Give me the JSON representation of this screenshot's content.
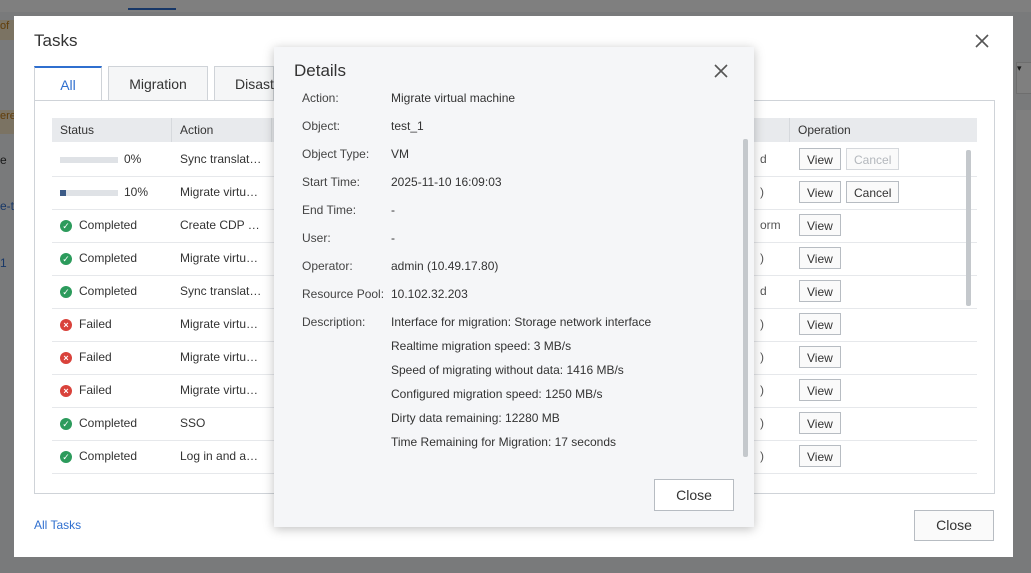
{
  "background": {
    "left_fragments": [
      "of",
      "ere",
      "e",
      "e-t",
      "1"
    ],
    "right_fragment": "▾"
  },
  "tasks_dialog": {
    "title": "Tasks",
    "tabs": [
      {
        "label": "All",
        "active": true
      },
      {
        "label": "Migration",
        "active": false
      },
      {
        "label": "Disast",
        "active": false
      }
    ],
    "table": {
      "headers": [
        "Status",
        "Action",
        "",
        "Operation"
      ],
      "rows": [
        {
          "status_type": "progress",
          "status": "0%",
          "progress": 0,
          "action": "Sync translat…",
          "tail": "d",
          "view": "View",
          "cancel": "Cancel",
          "cancel_enabled": false
        },
        {
          "status_type": "progress",
          "status": "10%",
          "progress": 10,
          "action": "Migrate virtu…",
          "tail": ")",
          "view": "View",
          "cancel": "Cancel",
          "cancel_enabled": true
        },
        {
          "status_type": "completed",
          "status": "Completed",
          "action": "Create CDP …",
          "tail": "orm",
          "view": "View"
        },
        {
          "status_type": "completed",
          "status": "Completed",
          "action": "Migrate virtu…",
          "tail": ")",
          "view": "View"
        },
        {
          "status_type": "completed",
          "status": "Completed",
          "action": "Sync translat…",
          "tail": "d",
          "view": "View"
        },
        {
          "status_type": "failed",
          "status": "Failed",
          "action": "Migrate virtu…",
          "tail": ")",
          "view": "View"
        },
        {
          "status_type": "failed",
          "status": "Failed",
          "action": "Migrate virtu…",
          "tail": ")",
          "view": "View"
        },
        {
          "status_type": "failed",
          "status": "Failed",
          "action": "Migrate virtu…",
          "tail": ")",
          "view": "View"
        },
        {
          "status_type": "completed",
          "status": "Completed",
          "action": "SSO",
          "tail": ")",
          "view": "View"
        },
        {
          "status_type": "completed",
          "status": "Completed",
          "action": "Log in and a…",
          "tail": ")",
          "view": "View"
        }
      ]
    },
    "all_tasks_link": "All Tasks",
    "close_label": "Close"
  },
  "details_dialog": {
    "title": "Details",
    "fields": [
      {
        "label": "Action:",
        "value": "Migrate virtual machine"
      },
      {
        "label": "Object:",
        "value": "test_1"
      },
      {
        "label": "Object Type:",
        "value": "VM"
      },
      {
        "label": "Start Time:",
        "value": "2025-11-10 16:09:03"
      },
      {
        "label": "End Time:",
        "value": "-"
      },
      {
        "label": "User:",
        "value": "-"
      },
      {
        "label": "Operator:",
        "value": "admin (10.49.17.80)"
      },
      {
        "label": "Resource Pool:",
        "value": "10.102.32.203"
      },
      {
        "label": "Description:",
        "value": "Interface for migration: Storage network interface"
      }
    ],
    "description_extra": [
      "Realtime migration speed: 3 MB/s",
      "Speed of migrating without data: 1416 MB/s",
      "Configured migration speed: 1250 MB/s",
      "Dirty data remaining: 12280 MB",
      "Time Remaining for Migration: 17 seconds"
    ],
    "close_label": "Close"
  },
  "colors": {
    "accent": "#2f6fcf",
    "success": "#2c9b5c",
    "danger": "#d9423b",
    "progress": "#3b5a86"
  }
}
